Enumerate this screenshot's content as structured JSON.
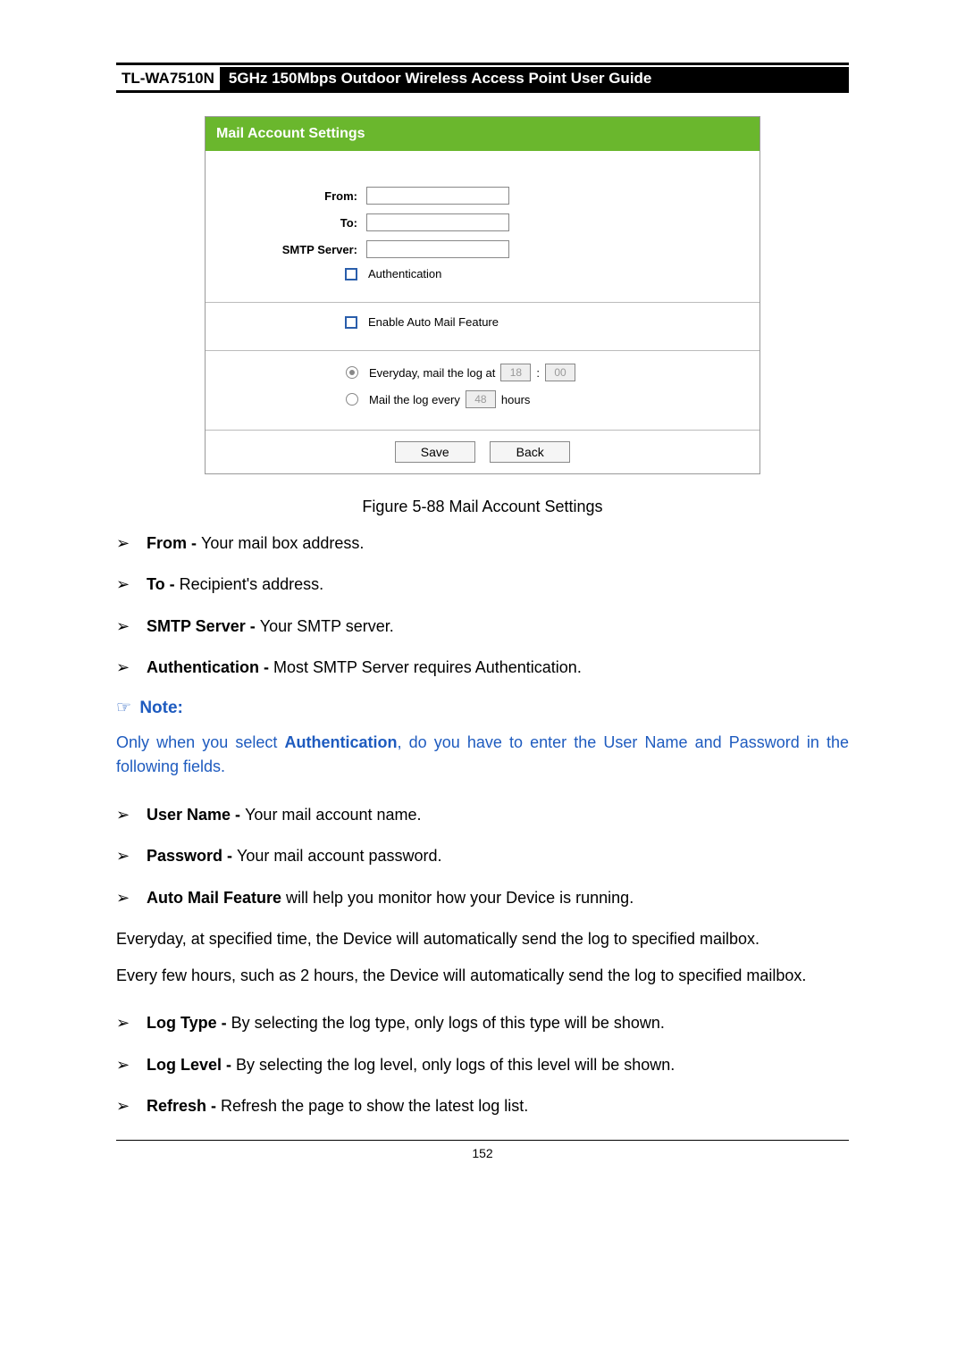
{
  "header": {
    "model": "TL-WA7510N",
    "title": "5GHz 150Mbps Outdoor Wireless Access Point User Guide"
  },
  "panel": {
    "title": "Mail Account Settings",
    "labels": {
      "from": "From:",
      "to": "To:",
      "smtp": "SMTP Server:",
      "auth": "Authentication",
      "enable_mail": "Enable Auto Mail Feature",
      "everyday_pre": "Everyday, mail the log at",
      "colon": ":",
      "hour": "18",
      "minute": "00",
      "every_pre": "Mail the log every",
      "every_val": "48",
      "every_suffix": "hours",
      "save": "Save",
      "back": "Back"
    }
  },
  "figure_caption": "Figure 5-88 Mail Account Settings",
  "bullets1": [
    {
      "term": "From - ",
      "desc": "Your mail box address."
    },
    {
      "term": "To - ",
      "desc": "Recipient's address."
    },
    {
      "term": "SMTP Server - ",
      "desc": "Your SMTP server."
    },
    {
      "term": "Authentication - ",
      "desc": "Most SMTP Server requires Authentication."
    }
  ],
  "note": {
    "icon": "☞",
    "label": "Note:",
    "body_pre": "Only when you select ",
    "body_bold": "Authentication",
    "body_post": ", do you have to enter the User Name and Password in the following fields."
  },
  "bullets2": [
    {
      "term": "User Name - ",
      "desc": "Your mail account name."
    },
    {
      "term": "Password - ",
      "desc": "Your mail account password."
    },
    {
      "term": "Auto Mail Feature ",
      "desc": "will help you monitor how your Device is running."
    }
  ],
  "para1": "Everyday, at specified time, the Device will automatically send the log to specified mailbox.",
  "para2": "Every few hours, such as 2 hours, the Device will automatically send the log to specified mailbox.",
  "bullets3": [
    {
      "term": "Log Type - ",
      "desc": "By selecting the log type, only logs of this type will be shown."
    },
    {
      "term": "Log Level - ",
      "desc": "By selecting the log level, only logs of this level will be shown."
    },
    {
      "term": "Refresh - ",
      "desc": "Refresh the page to show the latest log list."
    }
  ],
  "page_number": "152"
}
